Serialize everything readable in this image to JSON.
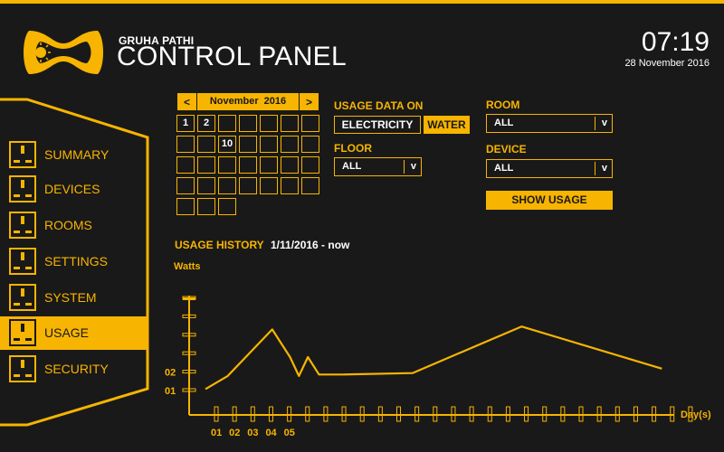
{
  "header": {
    "brand_small": "GRUHA PATHI",
    "brand_title": "CONTROL PANEL",
    "time": "07:19",
    "date": "28 November 2016"
  },
  "sidebar": {
    "items": [
      {
        "label": "SUMMARY",
        "icon": "socket-icon",
        "active": false
      },
      {
        "label": "DEVICES",
        "icon": "socket-icon",
        "active": false
      },
      {
        "label": "ROOMS",
        "icon": "socket-icon",
        "active": false
      },
      {
        "label": "SETTINGS",
        "icon": "socket-icon",
        "active": false
      },
      {
        "label": "SYSTEM",
        "icon": "socket-icon",
        "active": false
      },
      {
        "label": "USAGE",
        "icon": "socket-icon",
        "active": true
      },
      {
        "label": "SECURITY",
        "icon": "socket-icon",
        "active": false
      }
    ]
  },
  "calendar": {
    "prev": "<",
    "next": ">",
    "month": "November",
    "year": "2016",
    "rows": [
      [
        "1",
        "2",
        "",
        "",
        "",
        "",
        ""
      ],
      [
        "",
        "",
        "10",
        "",
        "",
        "",
        ""
      ],
      [
        "",
        "",
        "",
        "",
        "",
        "",
        ""
      ],
      [
        "",
        "",
        "",
        "",
        "",
        "",
        ""
      ],
      [
        "",
        "",
        ""
      ]
    ]
  },
  "filters": {
    "usage_label": "USAGE DATA ON",
    "electricity": "ELECTRICITY",
    "water": "WATER",
    "selected_type": "water",
    "floor_label": "FLOOR",
    "floor_value": "ALL",
    "room_label": "ROOM",
    "room_value": "ALL",
    "device_label": "DEVICE",
    "device_value": "ALL",
    "select_arrow": "v",
    "show_button": "SHOW USAGE"
  },
  "history": {
    "title": "USAGE HISTORY",
    "range": "1/11/2016 - now"
  },
  "chart_data": {
    "type": "line",
    "ylabel": "Watts",
    "xlabel": "Day(s)",
    "x_tick_labels": [
      "01",
      "02",
      "03",
      "04",
      "05"
    ],
    "y_tick_labels": [
      "01",
      "02"
    ],
    "x_ticks": 27,
    "y_ticks": 6,
    "x": [
      1,
      2,
      3,
      4,
      4.8,
      5.2,
      5.6,
      6.1,
      7.2,
      10.3,
      15.2,
      21.5
    ],
    "y": [
      0.1,
      1.0,
      2.6,
      4.2,
      2.3,
      1.0,
      2.3,
      1.1,
      1.1,
      1.2,
      4.4,
      1.5
    ],
    "accent": "#f7b400"
  },
  "colors": {
    "accent": "#f7b400",
    "background": "#191919",
    "text": "#ffffff"
  }
}
